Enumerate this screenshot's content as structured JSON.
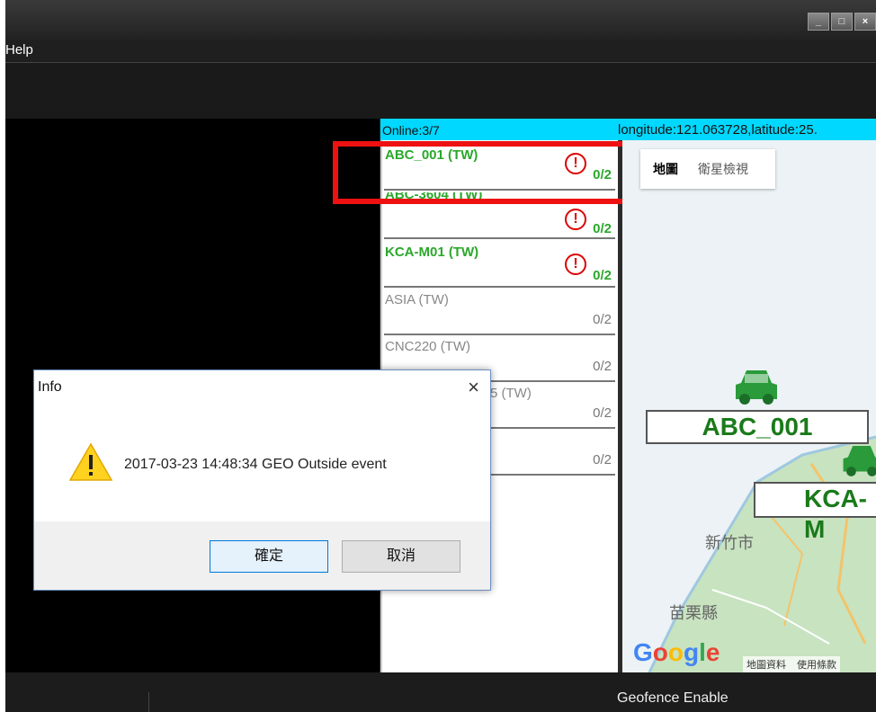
{
  "menu": {
    "help": "Help"
  },
  "window_controls": {
    "minimize": "_",
    "maximize": "□",
    "close": "×"
  },
  "status": {
    "online": "Online:3/7",
    "coords": "longitude:121.063728,latitude:25."
  },
  "devices": [
    {
      "name": "ABC_001 (TW)",
      "count": "0/2",
      "online": true,
      "alert": true
    },
    {
      "name": "ABC-3604 (TW)",
      "count": "0/2",
      "online": true,
      "alert": true
    },
    {
      "name": "KCA-M01 (TW)",
      "count": "0/2",
      "online": true,
      "alert": true
    },
    {
      "name": "ASIA (TW)",
      "count": "0/2",
      "online": false,
      "alert": false
    },
    {
      "name": "CNC220 (TW)",
      "count": "0/2",
      "online": false,
      "alert": false
    },
    {
      "name": "5 (TW)",
      "count": "0/2",
      "online": false,
      "alert": false
    },
    {
      "name": "",
      "count": "0/2",
      "online": false,
      "alert": false
    }
  ],
  "map": {
    "btn_map": "地圖",
    "btn_satellite": "衛星檢視",
    "vehicle1": "ABC_001",
    "vehicle2": "KCA-M",
    "city1": "新竹市",
    "city2": "苗栗縣",
    "google": "Google",
    "footer_data": "地圖資料",
    "footer_terms": "使用條款"
  },
  "footer": {
    "geofence": "Geofence Enable"
  },
  "dialog": {
    "title": "Info",
    "close": "×",
    "message": "2017-03-23 14:48:34 GEO Outside event",
    "ok": "確定",
    "cancel": "取消"
  },
  "colors": {
    "online": "#2aa82a",
    "highlight": "#e11111",
    "status_bar": "#00d8ff",
    "alert": "#dd0000"
  }
}
